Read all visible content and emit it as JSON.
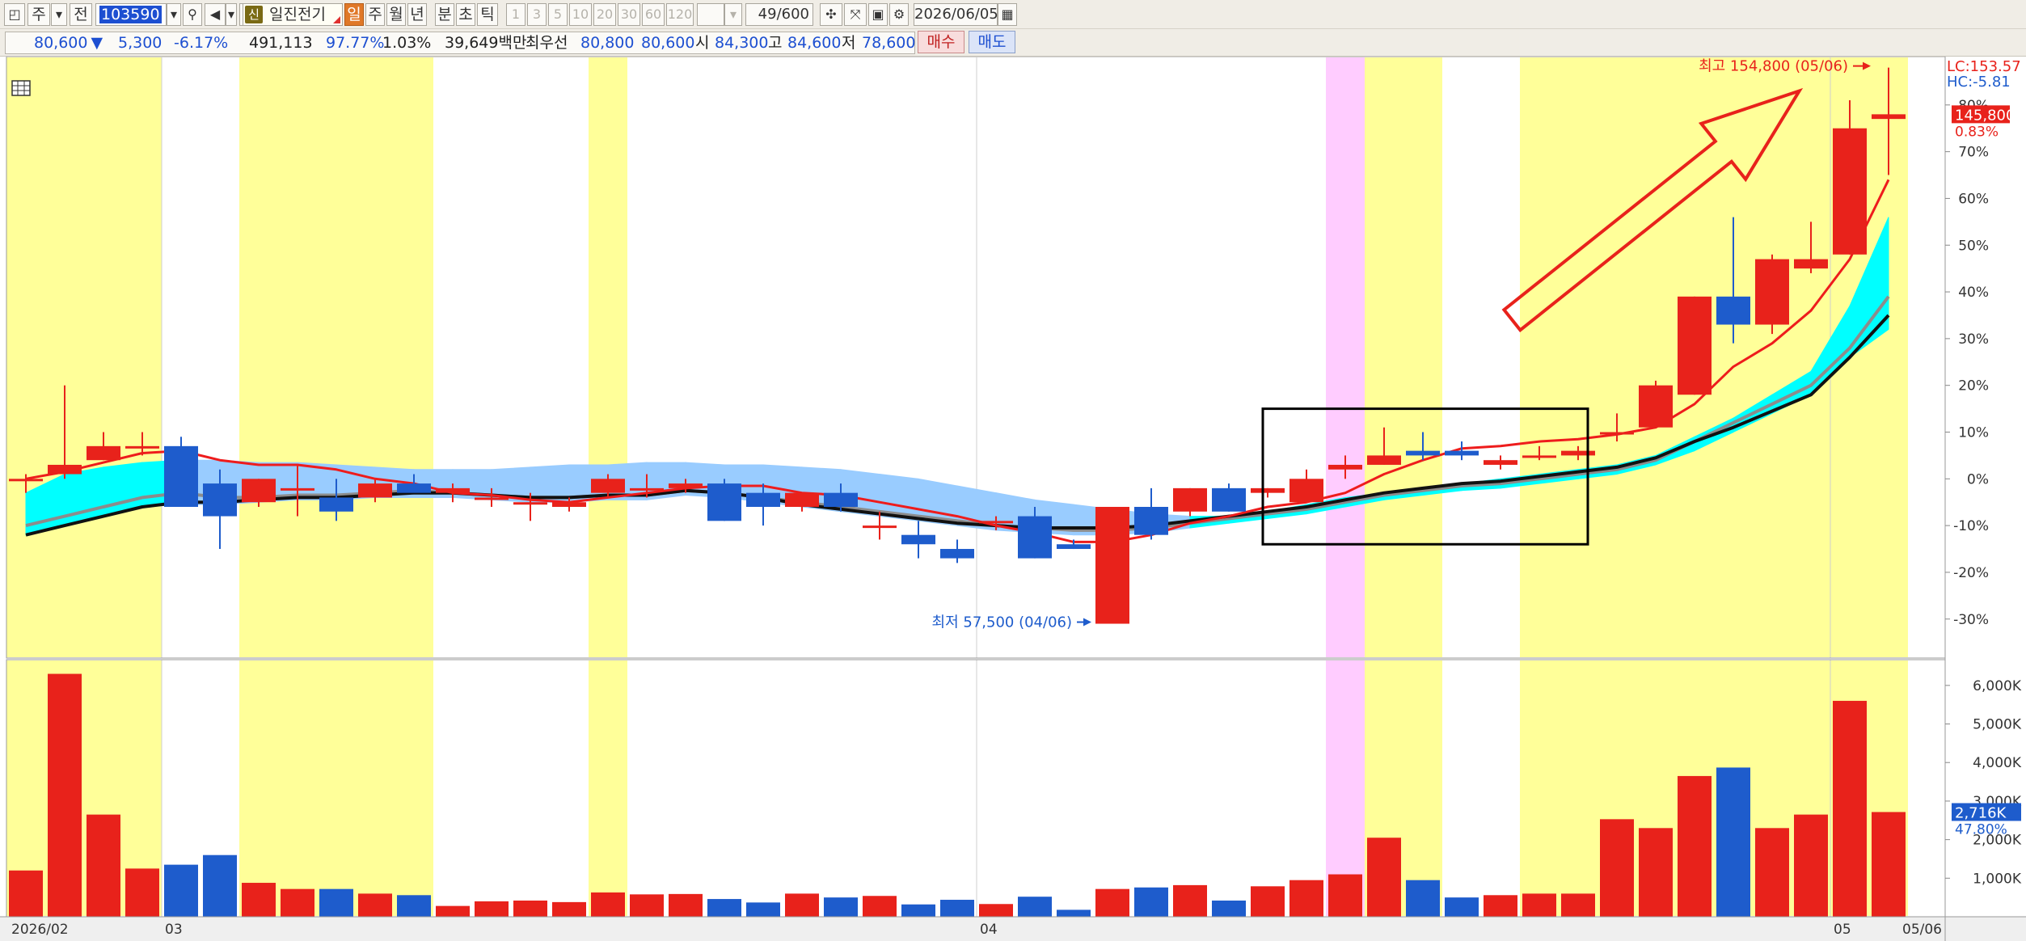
{
  "toolbar": {
    "period_short": "주",
    "prev_label": "전",
    "stock_code": "103590",
    "stock_name": "일진전기",
    "sin_badge": "신",
    "tabs": [
      "일",
      "주",
      "월",
      "년",
      "분",
      "초",
      "틱"
    ],
    "active_tab": "일",
    "intervals": [
      "1",
      "3",
      "5",
      "10",
      "20",
      "30",
      "60",
      "120"
    ],
    "count_current": "49",
    "count_max": "/600",
    "date": "2026/06/05"
  },
  "quote": {
    "price": "80,600",
    "change_arrow": "▼",
    "change": "5,300",
    "change_pct": "-6.17%",
    "volume": "491,113",
    "vol_ratio": "97.77%",
    "turnover": "1.03%",
    "amount": "39,649백만",
    "priority_label": "최우선",
    "ask": "80,800",
    "bid": "80,600",
    "open_label": "시",
    "open": "84,300",
    "high_label": "고",
    "high": "84,600",
    "low_label": "저",
    "low": "78,600",
    "buy_label": "매수",
    "sell_label": "매도"
  },
  "right_axis": {
    "lc": "LC:153.57",
    "hc": "HC:-5.81",
    "last_price_tag": "145,800",
    "last_pct_tag": "0.83%",
    "volume_tag": "2,716K",
    "volume_pct_tag": "47.80%"
  },
  "annotations": {
    "high_text": "최고 154,800 (05/06)",
    "low_text": "최저 57,500 (04/06)"
  },
  "chart_data": {
    "type": "candlestick",
    "y_unit": "% relative to base close",
    "ylim": [
      -38,
      90
    ],
    "y_ticks": [
      80,
      70,
      60,
      50,
      40,
      30,
      20,
      10,
      0,
      -10,
      -20,
      -30
    ],
    "y_tick_labels": [
      "80%",
      "70%",
      "60%",
      "50%",
      "40%",
      "30%",
      "20%",
      "10%",
      "0%",
      "-10%",
      "-20%",
      "-30%"
    ],
    "volume_ticks": [
      6000,
      5000,
      4000,
      3000,
      2000,
      1000
    ],
    "volume_tick_labels": [
      "6,000K",
      "5,000K",
      "4,000K",
      "3,000K",
      "2,000K",
      "1,000K"
    ],
    "volume_ylim": [
      0,
      6500
    ],
    "x_tick_labels": [
      {
        "index": 0,
        "label": "2026/02"
      },
      {
        "index": 4,
        "label": "03"
      },
      {
        "index": 25,
        "label": "04"
      },
      {
        "index": 47,
        "label": "05"
      }
    ],
    "x_right_label": "05/06",
    "candles": [
      {
        "o": 0,
        "h": 1,
        "l": -3,
        "c": 0,
        "v": 1200
      },
      {
        "o": 1,
        "h": 20,
        "l": 0,
        "c": 3,
        "v": 6300
      },
      {
        "o": 4,
        "h": 10,
        "l": 4,
        "c": 7,
        "v": 2650
      },
      {
        "o": 6.5,
        "h": 10,
        "l": 5,
        "c": 7,
        "v": 1250
      },
      {
        "o": 7,
        "h": 9,
        "l": -5,
        "c": -6,
        "v": 1350
      },
      {
        "o": -1,
        "h": 2,
        "l": -15,
        "c": -8,
        "v": 1600
      },
      {
        "o": -5,
        "h": 0,
        "l": -6,
        "c": 0,
        "v": 880
      },
      {
        "o": -2,
        "h": 3,
        "l": -8,
        "c": -2,
        "v": 720
      },
      {
        "o": -4,
        "h": 0,
        "l": -9,
        "c": -7,
        "v": 720
      },
      {
        "o": -4,
        "h": 0,
        "l": -5,
        "c": -1,
        "v": 600
      },
      {
        "o": -1,
        "h": 1,
        "l": -2,
        "c": -3,
        "v": 560
      },
      {
        "o": -3,
        "h": -1,
        "l": -5,
        "c": -2,
        "v": 280
      },
      {
        "o": -4,
        "h": -2,
        "l": -6,
        "c": -4,
        "v": 400
      },
      {
        "o": -5,
        "h": -3,
        "l": -9,
        "c": -5,
        "v": 420
      },
      {
        "o": -6,
        "h": -4,
        "l": -7,
        "c": -5,
        "v": 380
      },
      {
        "o": -3,
        "h": 1,
        "l": -4,
        "c": 0,
        "v": 630
      },
      {
        "o": -2,
        "h": 1,
        "l": -4,
        "c": -2,
        "v": 580
      },
      {
        "o": -2,
        "h": 0,
        "l": -3,
        "c": -1,
        "v": 590
      },
      {
        "o": -1,
        "h": 0,
        "l": -9,
        "c": -9,
        "v": 460
      },
      {
        "o": -3,
        "h": -1,
        "l": -10,
        "c": -6,
        "v": 370
      },
      {
        "o": -6,
        "h": -3,
        "l": -7,
        "c": -3,
        "v": 600
      },
      {
        "o": -3,
        "h": -1,
        "l": -7,
        "c": -6,
        "v": 500
      },
      {
        "o": -10,
        "h": -7,
        "l": -13,
        "c": -10,
        "v": 540
      },
      {
        "o": -12,
        "h": -9,
        "l": -17,
        "c": -14,
        "v": 320
      },
      {
        "o": -15,
        "h": -13,
        "l": -18,
        "c": -17,
        "v": 440
      },
      {
        "o": -9,
        "h": -8,
        "l": -11,
        "c": -9,
        "v": 330
      },
      {
        "o": -8,
        "h": -6,
        "l": -17,
        "c": -17,
        "v": 520
      },
      {
        "o": -14,
        "h": -13,
        "l": -15,
        "c": -15,
        "v": 180
      },
      {
        "o": -31,
        "h": -6,
        "l": -31,
        "c": -6,
        "v": 720
      },
      {
        "o": -6,
        "h": -2,
        "l": -13,
        "c": -12,
        "v": 760
      },
      {
        "o": -7,
        "h": -2,
        "l": -8,
        "c": -2,
        "v": 820
      },
      {
        "o": -2,
        "h": -1,
        "l": -7,
        "c": -7,
        "v": 420
      },
      {
        "o": -3,
        "h": -2,
        "l": -4,
        "c": -2,
        "v": 790
      },
      {
        "o": -5,
        "h": 2,
        "l": -5,
        "c": 0,
        "v": 950
      },
      {
        "o": 2,
        "h": 5,
        "l": 0,
        "c": 3,
        "v": 1100
      },
      {
        "o": 3,
        "h": 11,
        "l": 3,
        "c": 5,
        "v": 2050
      },
      {
        "o": 6,
        "h": 10,
        "l": 4,
        "c": 5,
        "v": 950
      },
      {
        "o": 6,
        "h": 8,
        "l": 4,
        "c": 5,
        "v": 500
      },
      {
        "o": 3,
        "h": 5,
        "l": 2,
        "c": 4,
        "v": 560
      },
      {
        "o": 5,
        "h": 7,
        "l": 4,
        "c": 5,
        "v": 600
      },
      {
        "o": 5,
        "h": 7,
        "l": 4,
        "c": 6,
        "v": 600
      },
      {
        "o": 10,
        "h": 14,
        "l": 8,
        "c": 10,
        "v": 2530
      },
      {
        "o": 11,
        "h": 21,
        "l": 11,
        "c": 20,
        "v": 2300
      },
      {
        "o": 18,
        "h": 39,
        "l": 18,
        "c": 39,
        "v": 3650
      },
      {
        "o": 39,
        "h": 56,
        "l": 29,
        "c": 33,
        "v": 3870
      },
      {
        "o": 33,
        "h": 48,
        "l": 31,
        "c": 47,
        "v": 2300
      },
      {
        "o": 45,
        "h": 55,
        "l": 44,
        "c": 47,
        "v": 2650
      },
      {
        "o": 48,
        "h": 81,
        "l": 48,
        "c": 75,
        "v": 5600
      },
      {
        "o": 77,
        "h": 88,
        "l": 65,
        "c": 78,
        "v": 2716
      }
    ],
    "ma_short": [
      0,
      1.5,
      3.5,
      5.5,
      6,
      4,
      3,
      3,
      2,
      0,
      -1,
      -3,
      -3.5,
      -4.5,
      -5,
      -4,
      -3,
      -2,
      -1.5,
      -1.5,
      -3,
      -3.5,
      -5,
      -6.5,
      -8,
      -10,
      -11.5,
      -13.5,
      -13.5,
      -12,
      -9.5,
      -8,
      -6,
      -5,
      -3,
      1,
      4,
      6.5,
      7,
      8,
      8.5,
      9.5,
      11,
      16,
      24,
      29,
      36,
      47,
      64
    ],
    "ma_grey": [
      -10,
      -8,
      -6,
      -4,
      -3,
      -4,
      -4,
      -3.5,
      -3.5,
      -3,
      -2.5,
      -3,
      -3.5,
      -4,
      -4,
      -3.5,
      -3.5,
      -2.5,
      -3,
      -4,
      -5,
      -6,
      -7,
      -8,
      -9,
      -10,
      -10.5,
      -11,
      -11,
      -10.5,
      -9.5,
      -8.5,
      -7.5,
      -6.5,
      -5,
      -3.5,
      -2.5,
      -1.5,
      -1,
      0,
      1,
      2,
      4,
      8,
      12,
      16,
      20,
      28,
      39
    ],
    "ma_black": [
      -12,
      -10,
      -8,
      -6,
      -5,
      -5,
      -4.5,
      -4,
      -4,
      -3.5,
      -3,
      -3,
      -3.5,
      -4,
      -4,
      -3.5,
      -3.5,
      -2.5,
      -3,
      -4,
      -5.5,
      -6.5,
      -7.5,
      -8.5,
      -9.5,
      -10,
      -10.5,
      -10.5,
      -10.5,
      -10,
      -9,
      -8,
      -7,
      -6,
      -4.5,
      -3,
      -2,
      -1,
      -0.5,
      0.5,
      1.5,
      2.5,
      4.5,
      8,
      11,
      14.5,
      18,
      26,
      35
    ],
    "cloud_upper": [
      -3,
      1,
      2.5,
      3.5,
      4,
      4,
      3.5,
      3.5,
      3,
      2.5,
      2,
      2,
      2,
      2.5,
      3,
      3,
      3.5,
      3.5,
      3,
      3,
      2.5,
      2,
      1,
      0,
      -1.5,
      -3,
      -4.5,
      -5.5,
      -6.5,
      -7.5,
      -8,
      -8,
      -7,
      -5.5,
      -4,
      -3,
      -2,
      -1,
      0,
      1,
      2,
      3,
      5,
      9,
      13,
      18,
      23,
      37,
      56
    ],
    "cloud_lower": [
      -12,
      -10,
      -8,
      -6,
      -5.5,
      -5.5,
      -5,
      -4.5,
      -4.5,
      -4,
      -4,
      -4,
      -4.5,
      -5,
      -5,
      -4.5,
      -4.5,
      -3.5,
      -4,
      -5,
      -6,
      -7,
      -8,
      -9,
      -10,
      -11,
      -11.5,
      -12,
      -12,
      -11.5,
      -10.5,
      -9.5,
      -8.5,
      -7.5,
      -6,
      -4.5,
      -3.5,
      -2.5,
      -2,
      -1,
      0,
      1,
      3,
      6,
      10,
      14,
      18,
      26,
      32
    ],
    "cloud_colors": {
      "bull": "#00ffff",
      "bear": "#99ccff"
    },
    "highlight_bands": [
      {
        "from": 0,
        "to": 3,
        "color": "#ffff99"
      },
      {
        "from": 6,
        "to": 10,
        "color": "#ffff99"
      },
      {
        "from": 15,
        "to": 15,
        "color": "#ffff99"
      },
      {
        "from": 34,
        "to": 34,
        "color": "#ffccff"
      },
      {
        "from": 35,
        "to": 36,
        "color": "#ffff99"
      },
      {
        "from": 39,
        "to": 48,
        "color": "#ffff99"
      }
    ],
    "colors": {
      "up": "#e8221b",
      "down": "#1e5ccc",
      "ma_short": "#ee1c1c",
      "ma_grey": "#8c8c8c",
      "ma_black": "#111111"
    },
    "high_point_index": 48,
    "low_point_index": 28,
    "box_range": {
      "from_index": 32,
      "to_index": 40,
      "y_top": 15,
      "y_bottom": -14
    },
    "arrow": {
      "from_index": 38.3,
      "from_y": 34,
      "to_index": 45.7,
      "to_y": 83
    }
  }
}
